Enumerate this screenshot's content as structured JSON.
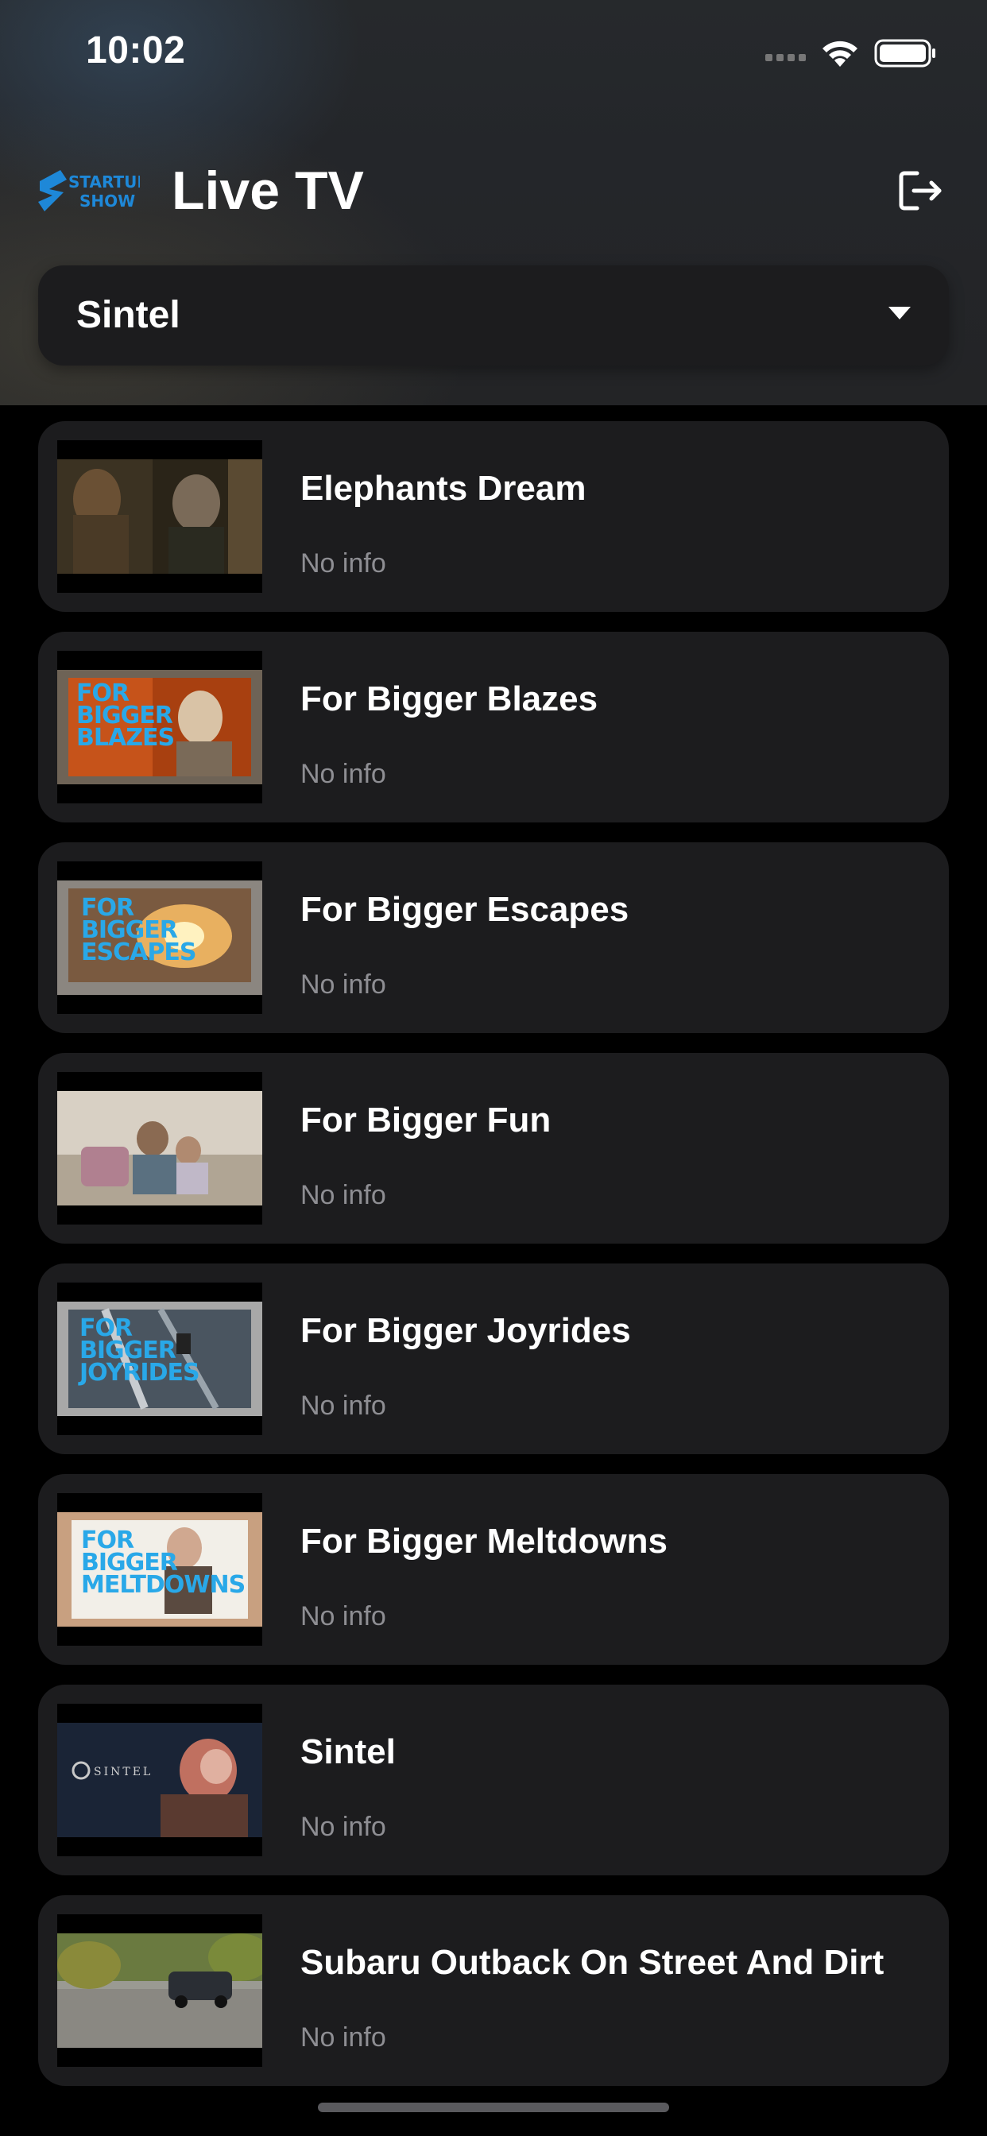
{
  "status_bar": {
    "time": "10:02"
  },
  "header": {
    "title": "Live TV",
    "logo_lines": [
      "STARTUP",
      "SHOW"
    ]
  },
  "selector": {
    "value": "Sintel"
  },
  "channels": [
    {
      "title": "Elephants Dream",
      "subtitle": "No info"
    },
    {
      "title": "For Bigger Blazes",
      "subtitle": "No info",
      "thumb_text": [
        "FOR",
        "BIGGER",
        "BLAZES"
      ]
    },
    {
      "title": "For Bigger Escapes",
      "subtitle": "No info",
      "thumb_text": [
        "FOR",
        "BIGGER",
        "ESCAPES"
      ]
    },
    {
      "title": "For Bigger Fun",
      "subtitle": "No info"
    },
    {
      "title": "For Bigger Joyrides",
      "subtitle": "No info",
      "thumb_text": [
        "FOR",
        "BIGGER",
        "JOYRIDES"
      ]
    },
    {
      "title": "For Bigger Meltdowns",
      "subtitle": "No info",
      "thumb_text": [
        "FOR",
        "BIGGER",
        "MELTDOWNS"
      ]
    },
    {
      "title": "Sintel",
      "subtitle": "No info",
      "thumb_text": [
        "SINTEL"
      ]
    },
    {
      "title": "Subaru Outback On Street And Dirt",
      "subtitle": "No info"
    }
  ],
  "colors": {
    "background": "#000000",
    "card": "#1c1c1e",
    "secondary_text": "#8e8e93",
    "logo_blue": "#1e88d8"
  }
}
